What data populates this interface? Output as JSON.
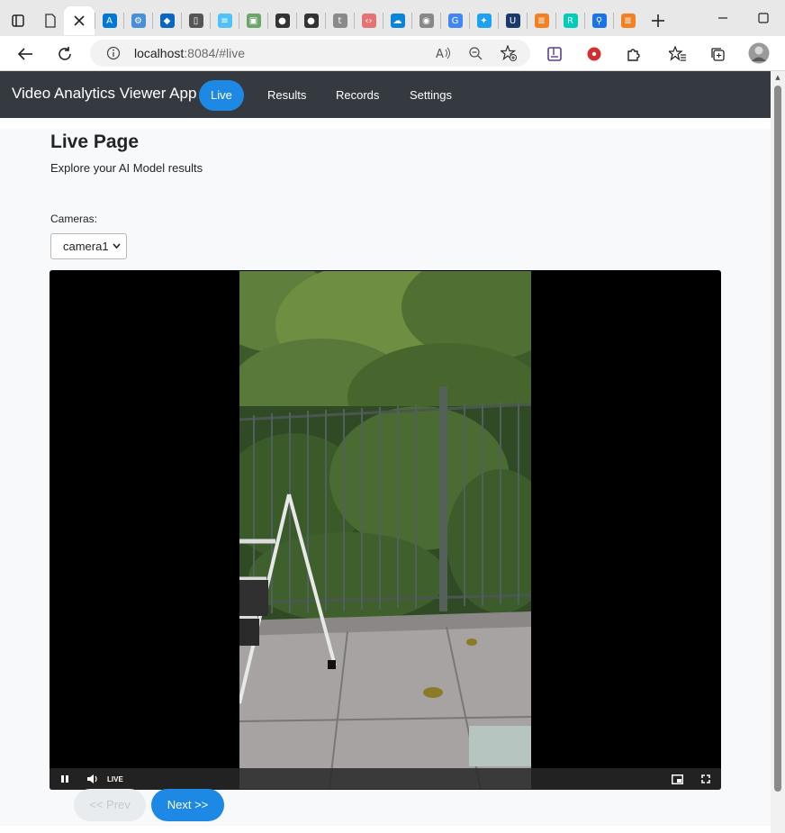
{
  "browser": {
    "tabs": [
      {
        "icon": "window-icon",
        "color": "#333333",
        "glyph": "▢"
      },
      {
        "icon": "page-icon",
        "color": "#555555",
        "glyph": "▯"
      },
      {
        "icon": "azure-icon",
        "color": "#0078d4",
        "glyph": "A"
      },
      {
        "icon": "settings-icon",
        "color": "#4a90d9",
        "glyph": "⚙"
      },
      {
        "icon": "devops-icon",
        "color": "#0a66c2",
        "glyph": "◆"
      },
      {
        "icon": "page-icon",
        "color": "#555555",
        "glyph": "▯"
      },
      {
        "icon": "layers-icon",
        "color": "#4fc3f7",
        "glyph": "≡"
      },
      {
        "icon": "image-icon",
        "color": "#6aa56a",
        "glyph": "▣"
      },
      {
        "icon": "github-icon",
        "color": "#333333",
        "glyph": "●"
      },
      {
        "icon": "github-icon",
        "color": "#333333",
        "glyph": "●"
      },
      {
        "icon": "tds-icon",
        "color": "#8a8a8a",
        "glyph": "t"
      },
      {
        "icon": "code-icon",
        "color": "#e57373",
        "glyph": "‹›"
      },
      {
        "icon": "cloud-icon",
        "color": "#0a84d8",
        "glyph": "☁"
      },
      {
        "icon": "broadcast-icon",
        "color": "#888888",
        "glyph": "◉"
      },
      {
        "icon": "google-icon",
        "color": "#4285f4",
        "glyph": "G"
      },
      {
        "icon": "twitter-icon",
        "color": "#1da1f2",
        "glyph": "✦"
      },
      {
        "icon": "ul-icon",
        "color": "#1b3a6b",
        "glyph": "U"
      },
      {
        "icon": "stackoverflow-icon",
        "color": "#f48024",
        "glyph": "≣"
      },
      {
        "icon": "researchgate-icon",
        "color": "#00ccbb",
        "glyph": "R"
      },
      {
        "icon": "search-icon",
        "color": "#1a73e8",
        "glyph": "⚲"
      },
      {
        "icon": "stackoverflow-icon",
        "color": "#f48024",
        "glyph": "≣"
      }
    ],
    "url_host": "localhost",
    "url_rest": ":8084/#live"
  },
  "app": {
    "brand": "Video Analytics Viewer App",
    "nav": {
      "live": "Live",
      "results": "Results",
      "records": "Records",
      "settings": "Settings"
    },
    "accent_color": "#1e88e5",
    "navbar_color": "#343a40"
  },
  "page": {
    "title": "Live Page",
    "subtitle": "Explore your AI Model results",
    "cameras_label": "Cameras:",
    "camera_selected": "camera1"
  },
  "player": {
    "live_label": "LIVE"
  },
  "pager": {
    "prev": "<< Prev",
    "next": "Next >>"
  }
}
